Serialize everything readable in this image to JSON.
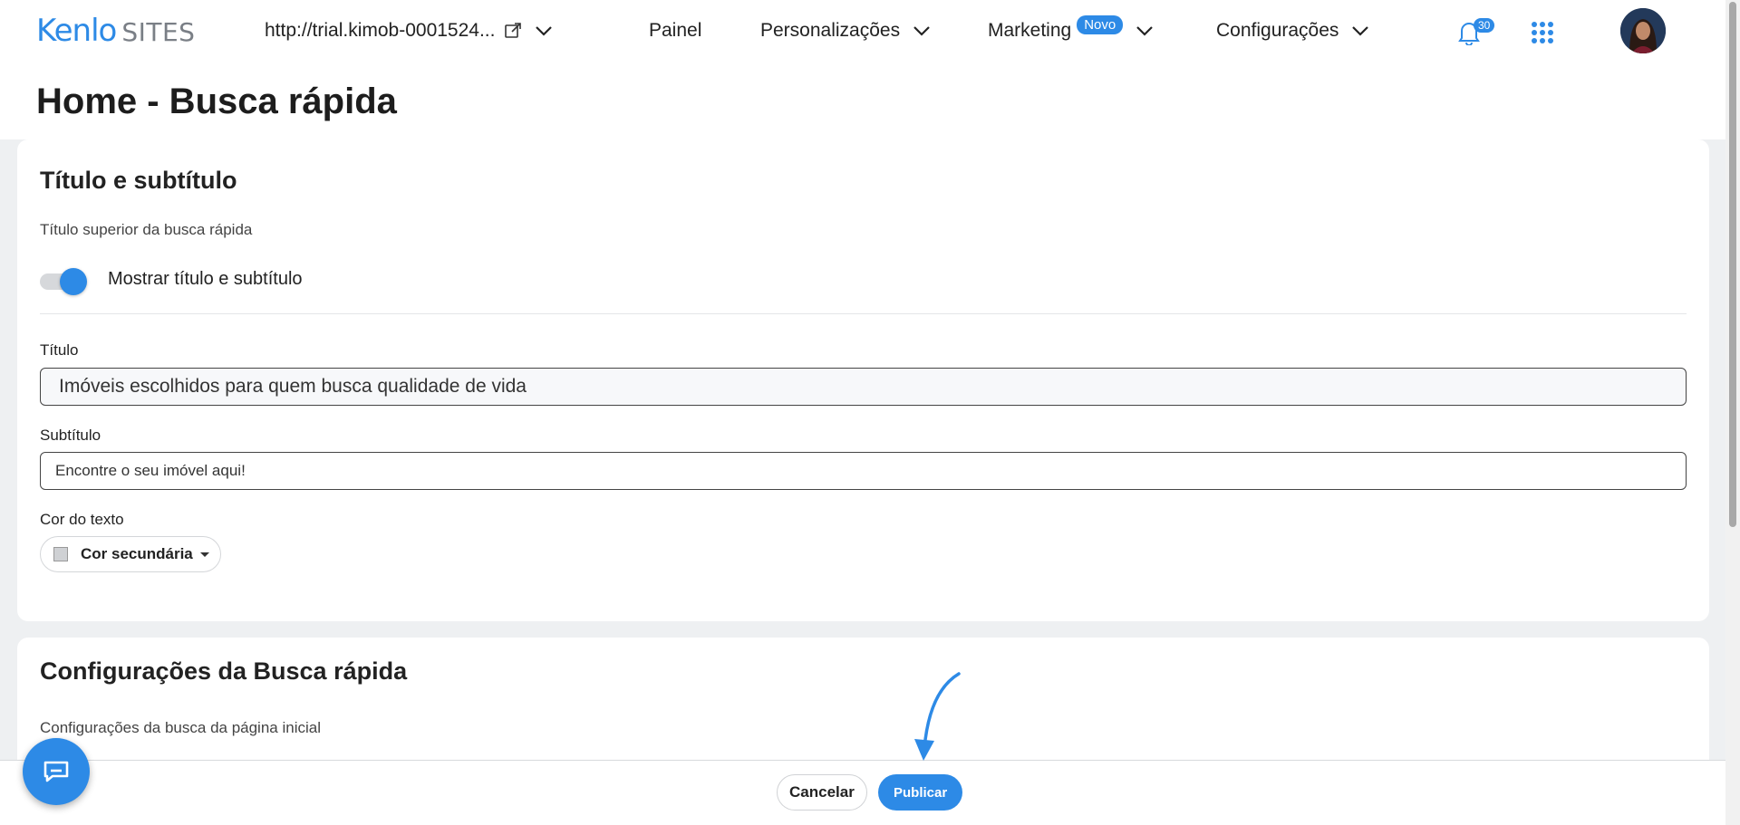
{
  "brand": {
    "name": "Kenlo",
    "product": "SITES"
  },
  "header": {
    "site_url": "http://trial.kimob-0001524...",
    "nav": [
      {
        "label": "Painel"
      },
      {
        "label": "Personalizações"
      },
      {
        "label": "Marketing",
        "badge": "Novo"
      },
      {
        "label": "Configurações"
      }
    ],
    "notifications_count": "30"
  },
  "page": {
    "title": "Home - Busca rápida"
  },
  "section_title": {
    "heading": "Título e subtítulo",
    "description": "Título superior da busca rápida",
    "toggle": {
      "label": "Mostrar título e subtítulo",
      "on": true
    },
    "titulo_label": "Título",
    "titulo_value": "Imóveis escolhidos para quem busca qualidade de vida",
    "subtitulo_label": "Subtítulo",
    "subtitulo_placeholder": "Encontre o seu imóvel aqui!",
    "cor_label": "Cor do texto",
    "cor_value": "Cor secundária"
  },
  "section_busca": {
    "heading": "Configurações da Busca rápida",
    "description": "Configurações da busca da página inicial"
  },
  "footer": {
    "cancel_label": "Cancelar",
    "publish_label": "Publicar"
  },
  "colors": {
    "accent": "#2d8ae6",
    "background": "#eef0f2"
  },
  "icons": {
    "external_link": "external-link-icon",
    "chevron": "chevron-down-icon",
    "bell": "bell-icon",
    "apps": "apps-grid-icon",
    "chat": "chat-icon",
    "arrow": "arrow-annotation-icon"
  }
}
